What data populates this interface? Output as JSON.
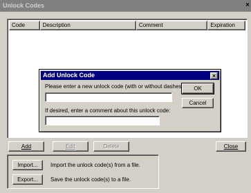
{
  "window": {
    "title": "Unlock Codes",
    "close_glyph": "×"
  },
  "list": {
    "columns": [
      "Code",
      "Description",
      "Comment",
      "Expiration"
    ]
  },
  "dialog": {
    "title": "Add Unlock Code",
    "close_glyph": "×",
    "code_prompt": "Please enter a new unlock code (with or without dashes):",
    "code_value": "",
    "comment_prompt": "If desired, enter a comment about this unlock code:",
    "comment_value": "",
    "ok_label": "OK",
    "cancel_label": "Cancel"
  },
  "buttons": {
    "add": "Add",
    "edit": "Edit",
    "delete": "Delete",
    "close": "Close"
  },
  "import_export": {
    "import_label": "Import...",
    "import_desc": "Import the unlock code(s) from a file.",
    "export_label": "Export...",
    "export_desc": "Save the unlock code(s) to a file."
  }
}
